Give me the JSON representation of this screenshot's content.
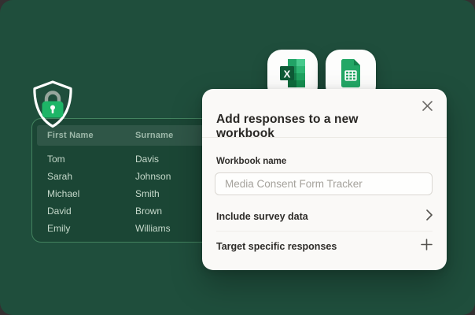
{
  "table": {
    "headers": [
      "First Name",
      "Surname"
    ],
    "rows": [
      [
        "Tom",
        "Davis"
      ],
      [
        "Sarah",
        "Johnson"
      ],
      [
        "Michael",
        "Smith"
      ],
      [
        "David",
        "Brown"
      ],
      [
        "Emily",
        "Williams"
      ]
    ]
  },
  "modal": {
    "title": "Add responses to a new workbook",
    "workbook_name_label": "Workbook name",
    "workbook_name_placeholder": "Media Consent Form Tracker",
    "options": [
      {
        "label": "Include survey data",
        "icon": "chevron-right-icon"
      },
      {
        "label": "Target specific responses",
        "icon": "plus-icon"
      }
    ]
  },
  "icons": {
    "shield": "shield-lock-icon",
    "excel": "excel-icon",
    "sheets": "google-sheets-icon",
    "close": "close-icon"
  },
  "colors": {
    "backdrop": "#343031",
    "background_green": "#1F4E3C",
    "accent_lock_green": "#1EB567",
    "table_border_green": "#43835F",
    "modal_background": "#FAF9F7",
    "excel_dark_green": "#0E5A36",
    "sheets_green": "#23A766"
  }
}
